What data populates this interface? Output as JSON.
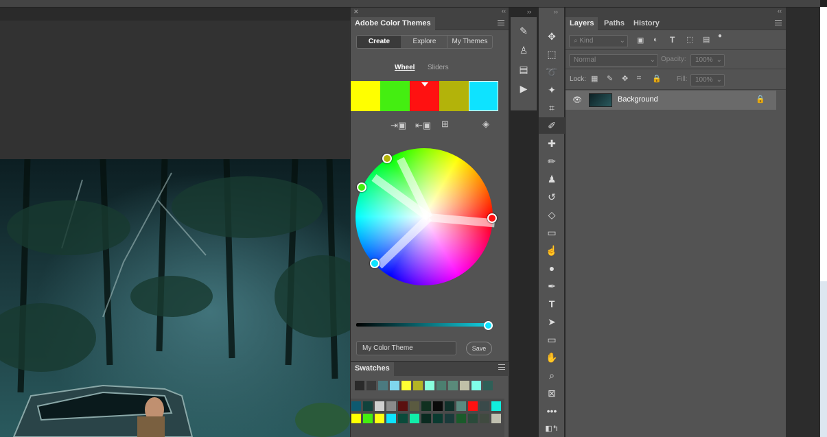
{
  "color_themes": {
    "title": "Adobe Color Themes",
    "tabs": [
      "Create",
      "Explore",
      "My Themes"
    ],
    "modes": {
      "wheel": "Wheel",
      "sliders": "Sliders"
    },
    "swatches": [
      "#ffff00",
      "#44ee11",
      "#ff1111",
      "#b3b30a",
      "#0ee3ff"
    ],
    "theme_name": "My Color Theme",
    "save_label": "Save"
  },
  "swatches_panel": {
    "title": "Swatches",
    "recent": [
      "#2a2a2a",
      "#3a3a3a",
      "#4b7a80",
      "#7fd6ee",
      "#ffff33",
      "#b4b424",
      "#88ffdd",
      "#4c7f70",
      "#5a8a7a",
      "#c0c0a8",
      "#7fffe8",
      "#2f5f57"
    ],
    "row1": [
      "#0e5a70",
      "#10423c",
      "#cfcfcf",
      "#8a8a8a",
      "#5a1010",
      "#5a5a40",
      "#103020",
      "#0a0a0a",
      "#10302a",
      "#5a8a80",
      "#ff1111",
      "#3a4a4a",
      "#11eedd"
    ],
    "row2": [
      "#ffff00",
      "#44ee11",
      "#ffff11",
      "#0ee3ff",
      "#0a4a3a",
      "#11eeaa",
      "#0a2a20",
      "#0a3a30",
      "#1a3a3a",
      "#1a5a2a",
      "#2a4a3a",
      "#404a40",
      "#c0c0b0"
    ]
  },
  "layers": {
    "tabs": [
      "Layers",
      "Paths",
      "History"
    ],
    "kind_placeholder": "Kind",
    "blend_mode": "Normal",
    "opacity_label": "Opacity:",
    "opacity_value": "100%",
    "lock_label": "Lock:",
    "fill_label": "Fill:",
    "fill_value": "100%",
    "layer_name": "Background"
  }
}
